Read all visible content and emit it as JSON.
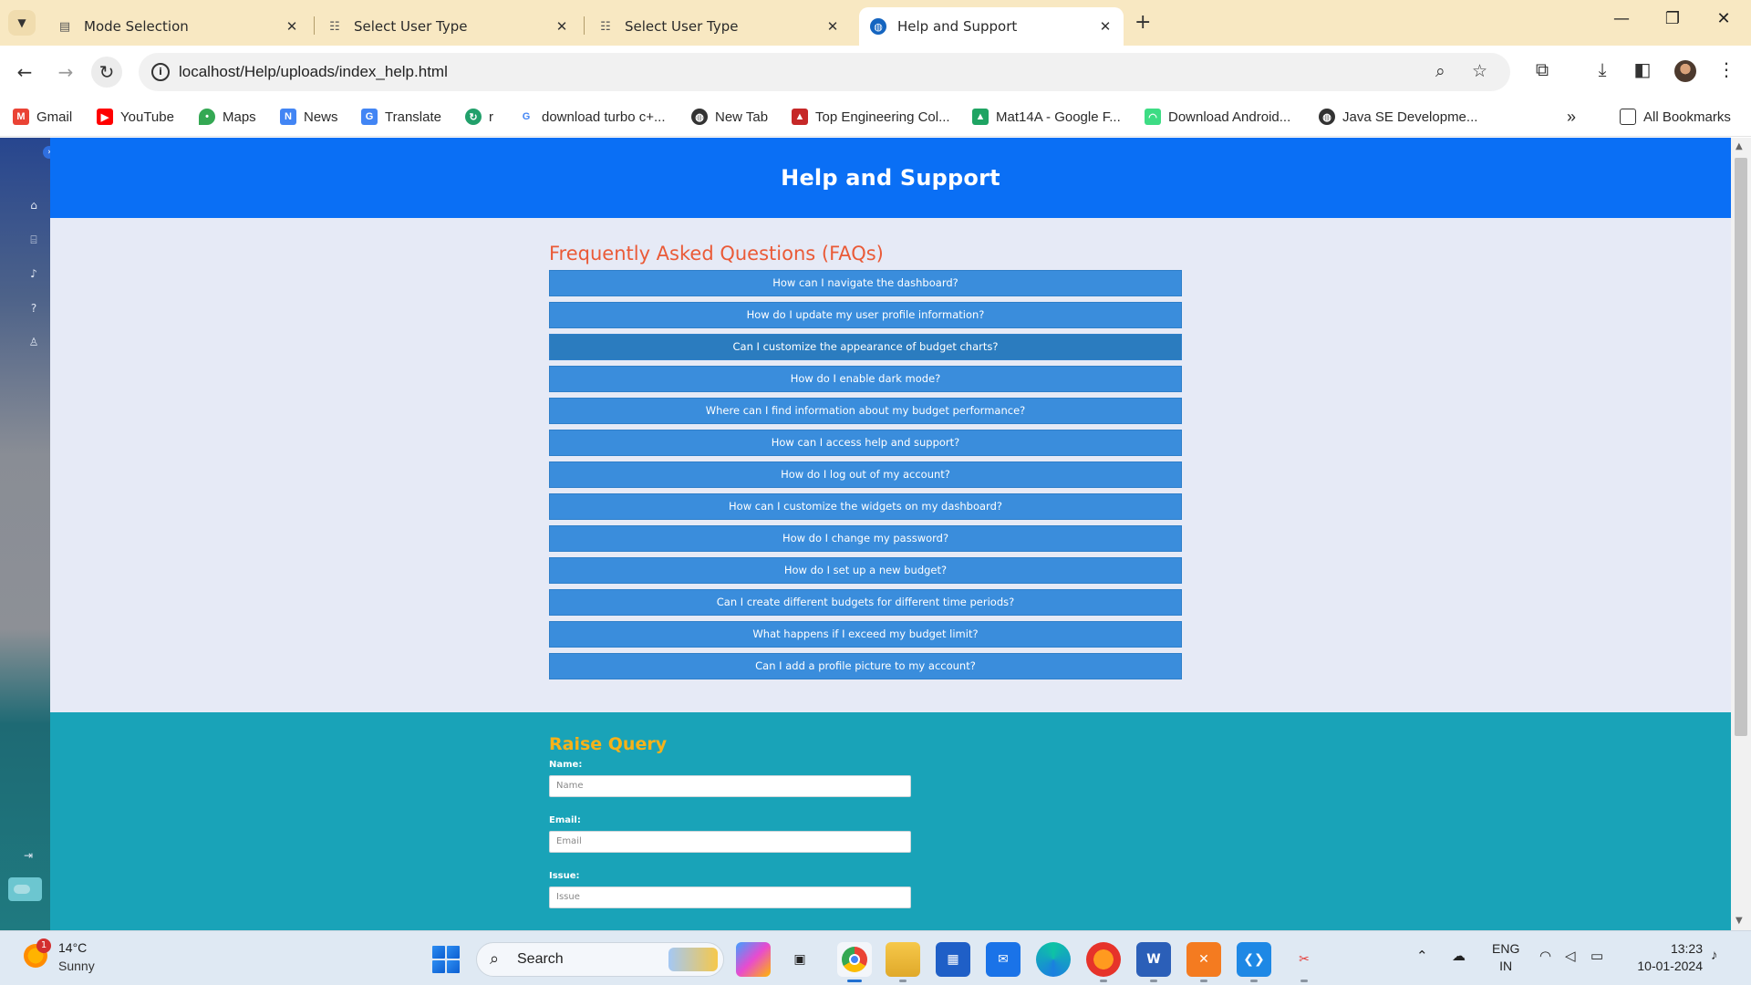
{
  "browser": {
    "tabs": [
      {
        "title": "Mode Selection",
        "icon": "page-icon",
        "active": false
      },
      {
        "title": "Select User Type",
        "icon": "users-icon",
        "active": false
      },
      {
        "title": "Select User Type",
        "icon": "users-icon",
        "active": false
      },
      {
        "title": "Help and Support",
        "icon": "globe-icon",
        "active": true
      }
    ],
    "url": "localhost/Help/uploads/index_help.html",
    "bookmarks": [
      {
        "label": "Gmail",
        "icon": "gmail-icon",
        "color": "#ea4335"
      },
      {
        "label": "YouTube",
        "icon": "youtube-icon",
        "color": "#ff0000"
      },
      {
        "label": "Maps",
        "icon": "maps-icon",
        "color": "#34a853"
      },
      {
        "label": "News",
        "icon": "news-icon",
        "color": "#4285f4"
      },
      {
        "label": "Translate",
        "icon": "translate-icon",
        "color": "#4285f4"
      },
      {
        "label": "r",
        "icon": "refresh-app-icon",
        "color": "#22a06b"
      },
      {
        "label": "download turbo c+...",
        "icon": "google-icon",
        "color": "#4285f4"
      },
      {
        "label": "New Tab",
        "icon": "globe-icon",
        "color": "#333333"
      },
      {
        "label": "Top Engineering Col...",
        "icon": "college-icon",
        "color": "#c62828"
      },
      {
        "label": "Mat14A - Google F...",
        "icon": "drive-icon",
        "color": "#1fa463"
      },
      {
        "label": "Download Android...",
        "icon": "android-icon",
        "color": "#3ddc84"
      },
      {
        "label": "Java SE Developme...",
        "icon": "globe-icon",
        "color": "#333333"
      }
    ],
    "all_bookmarks_label": "All Bookmarks"
  },
  "page": {
    "header_title": "Help and Support",
    "faq_title": "Frequently Asked Questions (FAQs)",
    "faqs": [
      "How can I navigate the dashboard?",
      "How do I update my user profile information?",
      "Can I customize the appearance of budget charts?",
      "How do I enable dark mode?",
      "Where can I find information about my budget performance?",
      "How can I access help and support?",
      "How do I log out of my account?",
      "How can I customize the widgets on my dashboard?",
      "How do I change my password?",
      "How do I set up a new budget?",
      "Can I create different budgets for different time periods?",
      "What happens if I exceed my budget limit?",
      "Can I add a profile picture to my account?"
    ],
    "query": {
      "title": "Raise Query",
      "name_label": "Name:",
      "name_placeholder": "Name",
      "email_label": "Email:",
      "email_placeholder": "Email",
      "issue_label": "Issue:",
      "issue_placeholder": "Issue"
    },
    "colors": {
      "header": "#0a6ff5",
      "faq_button": "#3a8ddc",
      "faq_title": "#ea5a37",
      "query_bg": "#19a3b8",
      "query_title": "#f6b21a"
    }
  },
  "taskbar": {
    "weather_temp": "14°C",
    "weather_desc": "Sunny",
    "weather_badge": "1",
    "search_label": "Search",
    "language_line1": "ENG",
    "language_line2": "IN",
    "time": "13:23",
    "date": "10-01-2024"
  }
}
